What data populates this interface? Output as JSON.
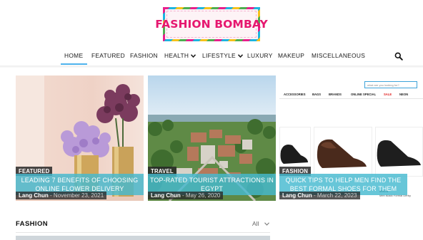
{
  "brand": {
    "logo_text": "FASHION BOMBAY"
  },
  "nav": {
    "items": [
      {
        "label": "HOME",
        "dropdown": false,
        "active": true
      },
      {
        "label": "FEATURED",
        "dropdown": false
      },
      {
        "label": "FASHION",
        "dropdown": false
      },
      {
        "label": "HEALTH",
        "dropdown": true
      },
      {
        "label": "LIFESTYLE",
        "dropdown": true
      },
      {
        "label": "LUXURY",
        "dropdown": false
      },
      {
        "label": "MAKEUP",
        "dropdown": false
      },
      {
        "label": "MISCELLANEOUS",
        "dropdown": false
      }
    ],
    "search_icon": "search-icon"
  },
  "cards": [
    {
      "category": "FEATURED",
      "title_line1": "LEADING 7 BENEFITS OF CHOOSING",
      "title_line2": "ONLINE FLOWER DELIVERY",
      "author": "Lang Chun",
      "date": "November 23, 2021"
    },
    {
      "category": "TRAVEL",
      "title_line1": "TOP-RATED TOURIST ATTRACTIONS IN",
      "title_line2": "EGYPT",
      "author": "Lang Chun",
      "date": "May 26, 2020"
    },
    {
      "category": "FASHION",
      "title_line1": "QUICK TIPS TO HELP MEN FIND THE",
      "title_line2": "BEST FORMAL SHOES FOR THEM",
      "author": "Lang Chun",
      "date": "March 22, 2023",
      "screenshot": {
        "search_placeholder": "what are you looking for?",
        "menu": [
          "ACCESSORIES",
          "BAGS",
          "BRANDS",
          "ONLINE SPECIAL",
          "SALE",
          "NEON"
        ],
        "product_brand": "Mochi",
        "product_name": "Men Black Formal Derby"
      }
    }
  ],
  "section": {
    "title": "FASHION",
    "filter_label": "All"
  },
  "colors": {
    "accent": "#4db2ec",
    "title_band": "#46b9cf",
    "logo": "#e6176f",
    "sale": "#e02020"
  }
}
